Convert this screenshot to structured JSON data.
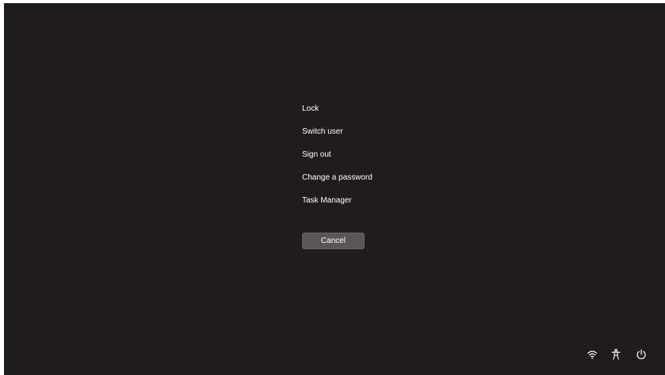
{
  "menu": {
    "items": [
      {
        "label": "Lock"
      },
      {
        "label": "Switch user"
      },
      {
        "label": "Sign out"
      },
      {
        "label": "Change a password"
      },
      {
        "label": "Task Manager"
      }
    ]
  },
  "cancel_button": {
    "label": "Cancel"
  },
  "tray": {
    "icons": [
      "wifi-icon",
      "accessibility-icon",
      "power-icon"
    ]
  },
  "colors": {
    "background": "#201c1c",
    "text": "#ffffff",
    "button": "#5a5656"
  }
}
